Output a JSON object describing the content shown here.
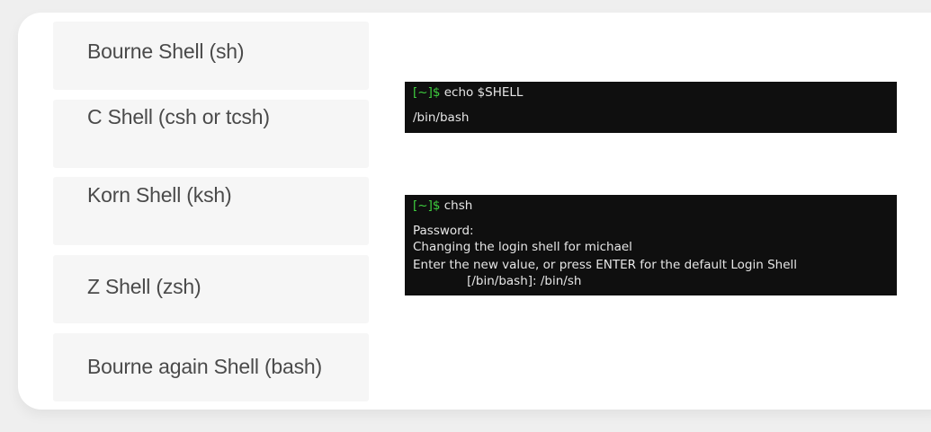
{
  "shells": [
    {
      "label": "Bourne Shell (sh)"
    },
    {
      "label": "C Shell (csh or tcsh)"
    },
    {
      "label": "Korn Shell (ksh)"
    },
    {
      "label": "Z Shell (zsh)"
    },
    {
      "label": "Bourne again Shell (bash)"
    }
  ],
  "terminal1": {
    "prompt": "[~]$",
    "command": " echo $SHELL",
    "output": "/bin/bash"
  },
  "terminal2": {
    "prompt": "[~]$",
    "command": " chsh",
    "lines": [
      "Password:",
      "Changing the login shell for michael",
      "Enter the new value, or press ENTER for the default Login Shell",
      "              [/bin/bash]: /bin/sh"
    ]
  },
  "colors": {
    "prompt": "#3fcf3f",
    "terminal_bg": "#0f0f0f",
    "item_bg": "#f6f6f6"
  }
}
